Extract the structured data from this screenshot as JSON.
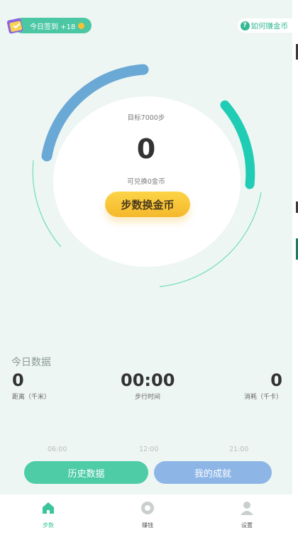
{
  "header": {
    "checkin_label": "今日签到 +18",
    "help_label": "如何赚金币"
  },
  "ring": {
    "target_text": "目标7000步",
    "steps_value": "0",
    "exchange_text": "可兑换0金币",
    "convert_button": "步数换金币"
  },
  "today": {
    "title": "今日数据",
    "stats": [
      {
        "value": "0",
        "label": "距离（千米）"
      },
      {
        "value": "00:00",
        "label": "步行时间"
      },
      {
        "value": "0",
        "label": "消耗（千卡）"
      }
    ],
    "times": [
      "06:00",
      "12:00",
      "21:00"
    ]
  },
  "buttons": {
    "history": "历史数据",
    "achievements": "我的成就"
  },
  "tabs": [
    {
      "label": "步数",
      "icon": "home-icon",
      "active": true
    },
    {
      "label": "赚钱",
      "icon": "coin-icon",
      "active": false
    },
    {
      "label": "设置",
      "icon": "user-icon",
      "active": false
    }
  ],
  "colors": {
    "accent": "#4cc7a4",
    "blue_arc": "#6aa8d6",
    "teal_arc": "#20cdb4",
    "gold": "#f6c233"
  }
}
